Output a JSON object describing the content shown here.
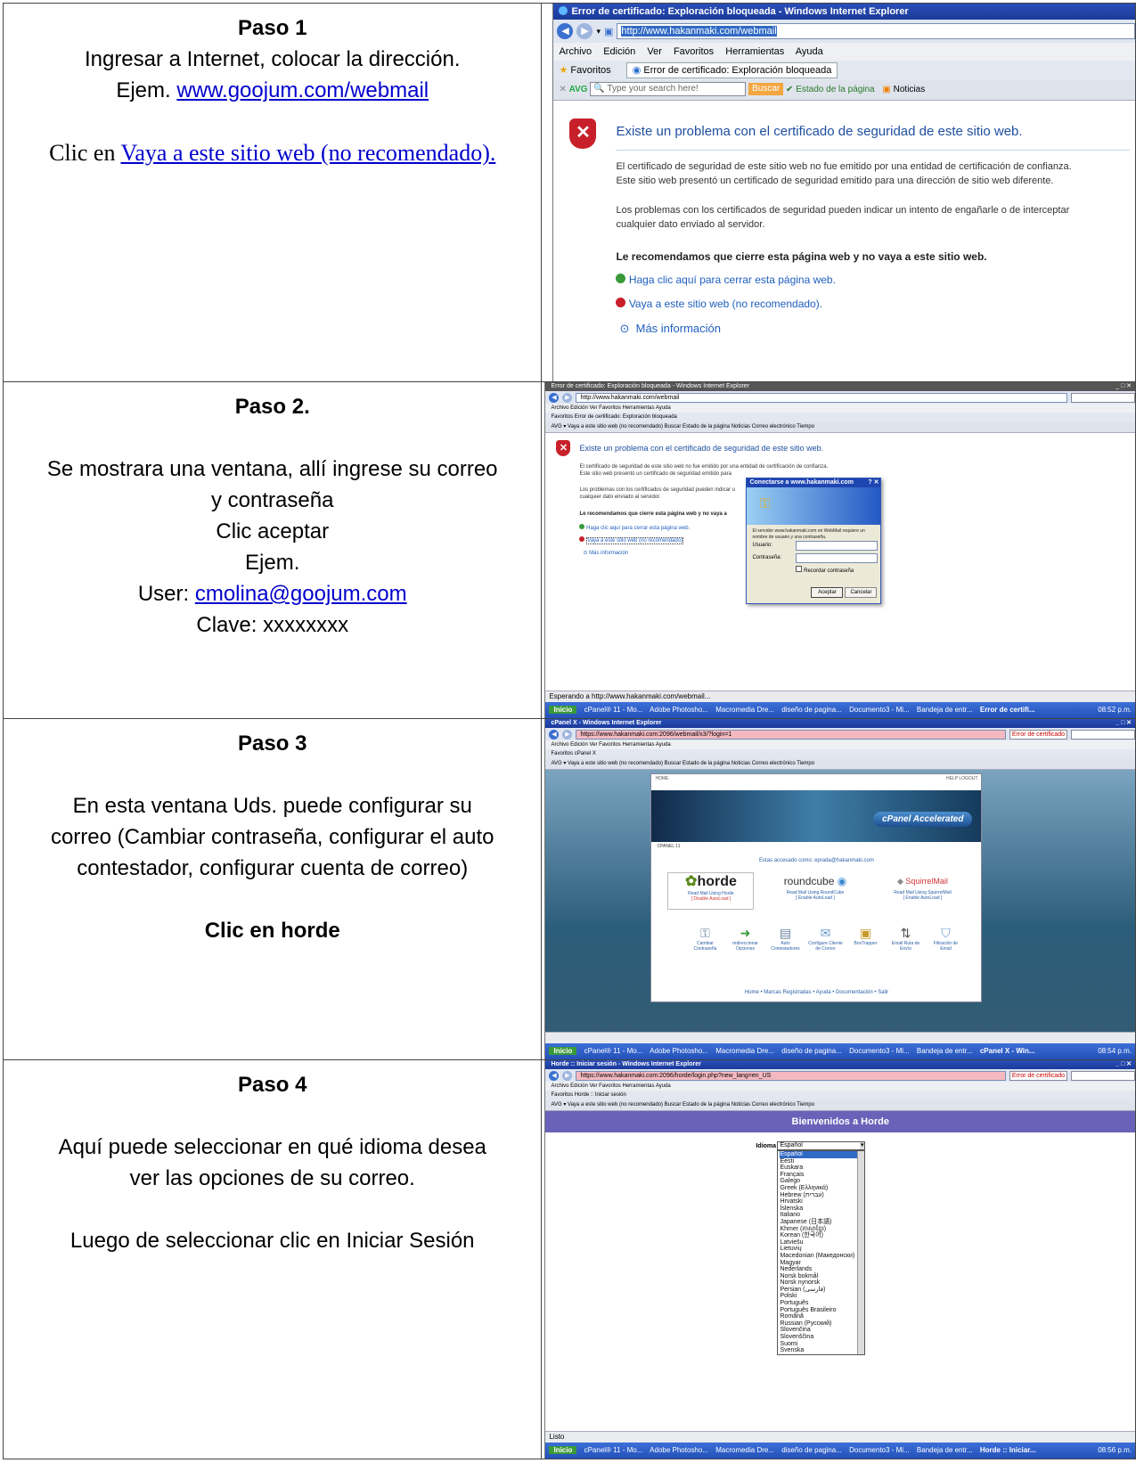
{
  "steps": [
    {
      "title": "Paso 1",
      "line1": "Ingresar a Internet, colocar la dirección.",
      "line2_prefix": "Ejem. ",
      "line2_link": "www.goojum.com/webmail",
      "click_prefix": "Clic en ",
      "click_link": "Vaya a este sitio web (no recomendado)."
    },
    {
      "title": "Paso 2.",
      "line1": "Se mostrara una ventana, allí ingrese su correo",
      "line2": "y contraseña",
      "line3": "Clic aceptar",
      "line4": "Ejem.",
      "user_prefix": "User: ",
      "user_link": "cmolina@goojum.com",
      "clave": "Clave: xxxxxxxx"
    },
    {
      "title": "Paso 3",
      "line1": "En esta ventana Uds. puede configurar su",
      "line2": "correo (Cambiar contraseña, configurar el auto",
      "line3": "contestador, configurar cuenta de correo)",
      "bold": "Clic en horde"
    },
    {
      "title": "Paso 4",
      "line1": "Aquí puede seleccionar en qué idioma desea",
      "line2": "ver las opciones de su correo.",
      "line3": "Luego de seleccionar clic en Iniciar Sesión"
    }
  ],
  "shot1": {
    "window_title": "Error de certificado: Exploración bloqueada - Windows Internet Explorer",
    "url": "http://www.hakanmaki.com/webmail",
    "menu": [
      "Archivo",
      "Edición",
      "Ver",
      "Favoritos",
      "Herramientas",
      "Ayuda"
    ],
    "favorites": "Favoritos",
    "tab": "Error de certificado: Exploración bloqueada",
    "avg": "AVG",
    "search_placeholder": "Type your search here!",
    "buscar": "Buscar",
    "estado": "Estado de la página",
    "noticias": "Noticias",
    "heading": "Existe un problema con el certificado de seguridad de este sitio web.",
    "p1a": "El certificado de seguridad de este sitio web no fue emitido por una entidad de certificación de confianza.",
    "p1b": "Este sitio web presentó un certificado de seguridad emitido para una dirección de sitio web diferente.",
    "p2a": "Los problemas con los certificados de seguridad pueden indicar un intento de engañarle o de interceptar",
    "p2b": "cualquier dato enviado al servidor.",
    "recommend": "Le recomendamos que cierre esta página web y no vaya a este sitio web.",
    "close_link": "Haga clic aquí para cerrar esta página web.",
    "go_link": "Vaya a este sitio web (no recomendado).",
    "more": "Más información"
  },
  "shot2": {
    "window_title": "Error de certificado: Exploración bloqueada - Windows Internet Explorer",
    "url": "http://www.hakanmaki.com/webmail",
    "menu": "Archivo   Edición   Ver   Favoritos   Herramientas   Ayuda",
    "favs": "Favoritos      Error de certificado: Exploración bloqueada",
    "avg": "AVG  ▾  Vaya a este sitio web (no recomendado)   Buscar   Estado de la página   Noticias   Correo electrónico   Tiempo",
    "heading": "Existe un problema con el certificado de seguridad de este sitio web.",
    "p1": "El certificado de seguridad de este sitio web no fue emitido por una entidad de certificación de confianza.",
    "p1b": "Este sitio web presentó un certificado de seguridad emitido para",
    "p2": "Los problemas con los certificados de seguridad pueden indicar u",
    "p2b": "cualquier dato enviado al servidor.",
    "recommend": "Le recomendamos que cierre esta página web y no vaya a",
    "close_link": "Haga clic aquí para cerrar esta página web.",
    "go_link": "Vaya a este sitio web (no recomendado)",
    "more": "Más información",
    "dialog_title": "Conectarse a www.hakanmaki.com",
    "dialog_msg": "El servidor www.hakanmaki.com en WebMail requiere un nombre de usuario y una contraseña.",
    "user_label": "Usuario:",
    "pass_label": "Contraseña:",
    "remember": "Recordar contraseña",
    "ok": "Aceptar",
    "cancel": "Cancelar",
    "status": "Esperando a http://www.hakanmaki.com/webmail...",
    "task": [
      "Inicio",
      "cPanel® 11 - Mo...",
      "Adobe Photosho...",
      "Macromedia Dre...",
      "diseño de pagina...",
      "Documento3 - Mi...",
      "Bandeja de entr...",
      "Error de certifi..."
    ],
    "clock": "08:52 p.m."
  },
  "shot3": {
    "window_title": "cPanel X - Windows Internet Explorer",
    "url": "https://www.hakanmaki.com:2096/webmail/x3/?login=1",
    "cert_err": "Error de certificado",
    "menu": "Archivo   Edición   Ver   Favoritos   Herramientas   Ayuda",
    "favs": "Favoritos      cPanel X",
    "avg": "AVG  ▾  Vaya a este sitio web (no recomendado)   Buscar   Estado de la página   Noticias   Correo electrónico   Tiempo",
    "home": "HOME",
    "help": "HELP   LOGOUT",
    "cpanel": "cPanel Accelerated",
    "cpanel_ver": "CPANEL 11",
    "accessing": "Estas accesado como: eprada@hakanmaki.com",
    "horde": "horde",
    "horde_sub": "Read Mail Using Horde",
    "horde_auto": "[ Disable AutoLoad ]",
    "roundcube": "roundcube",
    "rc_sub": "Read Mail Using RoundCube",
    "rc_auto": "[ Enable AutoLoad ]",
    "squirrel": "SquirrelMail",
    "sq_sub": "Read Mail Using SquirrelMail",
    "sq_auto": "[ Enable AutoLoad ]",
    "icons": [
      "Cambiar Contraseña",
      "redireccionar Opciones",
      "Auto Contestadores",
      "Configure Cliente de Correo",
      "BoxTrapper",
      "Email Ruta de Envío",
      "Filtración de Email"
    ],
    "footer": "Home  •  Marcas Registradas  •  Ayuda  •  Documentación  •  Salir",
    "task": [
      "Inicio",
      "cPanel® 11 - Mo...",
      "Adobe Photosho...",
      "Macromedia Dre...",
      "diseño de pagina...",
      "Documento3 - Mi...",
      "Bandeja de entr...",
      "cPanel X - Win..."
    ],
    "clock": "08:54 p.m."
  },
  "shot4": {
    "window_title": "Horde :: Iniciar sesión - Windows Internet Explorer",
    "url": "https://www.hakanmaki.com:2096/horde/login.php?new_lang=en_US",
    "cert_err": "Error de certificado",
    "menu": "Archivo   Edición   Ver   Favoritos   Herramientas   Ayuda",
    "favs": "Favoritos      Horde :: Iniciar sesión",
    "avg": "AVG  ▾  Vaya a este sitio web (no recomendado)   Buscar   Estado de la página   Noticias   Correo electrónico   Tiempo",
    "welcome": "Bienvenidos a Horde",
    "idioma": "Idioma",
    "selected": "Español",
    "languages": [
      "Español",
      "Eesti",
      "Euskara",
      "Français",
      "Galego",
      "Greek (Ελληνικά)",
      "Hebrew (עברית)",
      "Hrvatski",
      "Íslenska",
      "Italiano",
      "Japanese (日本語)",
      "Khmer (ភាសាខ្មែរ)",
      "Korean (한국어)",
      "Latviešu",
      "Lietuvių",
      "Macedonian (Македонски)",
      "Magyar",
      "Nederlands",
      "Norsk bokmål",
      "Norsk nynorsk",
      "Persian (فارسی)",
      "Polski",
      "Português",
      "Português Brasileiro",
      "Română",
      "Russian (Русский)",
      "Slovenčina",
      "Slovenščina",
      "Suomi",
      "Svenska"
    ],
    "status": "Listo",
    "task": [
      "Inicio",
      "cPanel® 11 - Mo...",
      "Adobe Photosho...",
      "Macromedia Dre...",
      "diseño de pagina...",
      "Documento3 - Mi...",
      "Bandeja de entr...",
      "Horde :: Iniciar..."
    ],
    "clock": "08:56 p.m."
  }
}
